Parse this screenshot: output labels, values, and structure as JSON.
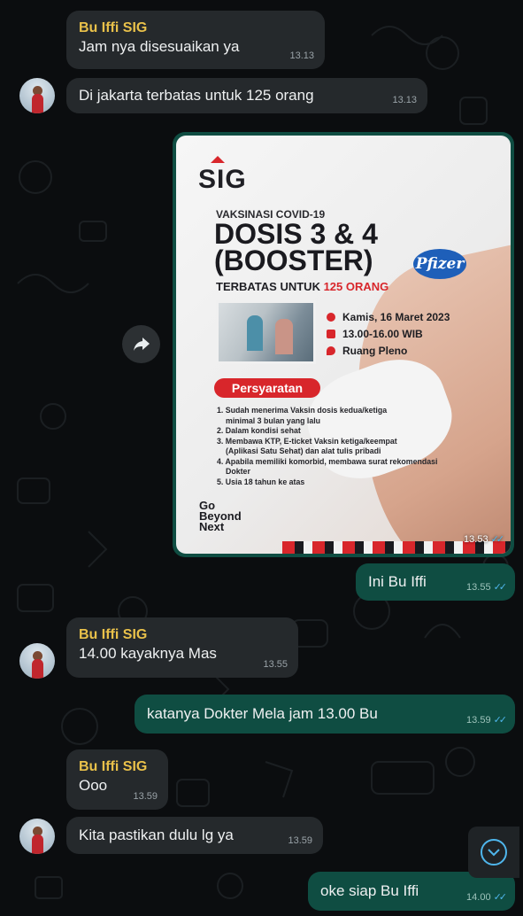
{
  "messages": [
    {
      "sender": "Bu Iffi SIG",
      "text": "Jam nya disesuaikan ya",
      "time": "13.13"
    },
    {
      "text": "Di jakarta terbatas untuk 125 orang",
      "time": "13.13"
    },
    {
      "image_time": "13.53"
    },
    {
      "text": "Ini Bu Iffi",
      "time": "13.55"
    },
    {
      "sender": "Bu Iffi SIG",
      "text": "14.00 kayaknya Mas",
      "time": "13.55"
    },
    {
      "text": "katanya Dokter Mela jam 13.00 Bu",
      "time": "13.59"
    },
    {
      "sender": "Bu Iffi SIG",
      "text": "Ooo",
      "time": "13.59"
    },
    {
      "text": "Kita pastikan dulu lg ya",
      "time": "13.59"
    },
    {
      "text": "oke siap Bu Iffi",
      "time": "14.00"
    }
  ],
  "read_ticks": "✓✓",
  "poster": {
    "logo": "SIG",
    "subtitle": "VAKSINASI COVID-19",
    "headline_1": "DOSIS 3 & 4",
    "headline_2": "(BOOSTER)",
    "brand": "Pfizer",
    "limit_prefix": "TERBATAS UNTUK ",
    "limit_highlight": "125 ORANG",
    "date": "Kamis, 16 Maret 2023",
    "hours": "13.00-16.00 WIB",
    "place": "Ruang Pleno",
    "requirements_title": "Persyaratan",
    "requirements": [
      "1. Sudah menerima Vaksin dosis kedua/ketiga",
      "    minimal 3 bulan yang lalu",
      "2. Dalam kondisi sehat",
      "3. Membawa KTP, E-ticket Vaksin ketiga/keempat",
      "    (Aplikasi Satu Sehat) dan alat tulis pribadi",
      "4. Apabila memiliki komorbid, membawa surat rekomendasi",
      "    Dokter",
      "5. Usia 18 tahun ke atas"
    ],
    "tagline_1": "Go",
    "tagline_2": "Beyond",
    "tagline_3": "Next"
  },
  "colors": {
    "incoming_bubble": "#25292c",
    "outgoing_bubble": "#0f4d42",
    "sender_name": "#e9c14a",
    "read_ticks": "#4fb6ec",
    "brand_red": "#d8262b"
  }
}
